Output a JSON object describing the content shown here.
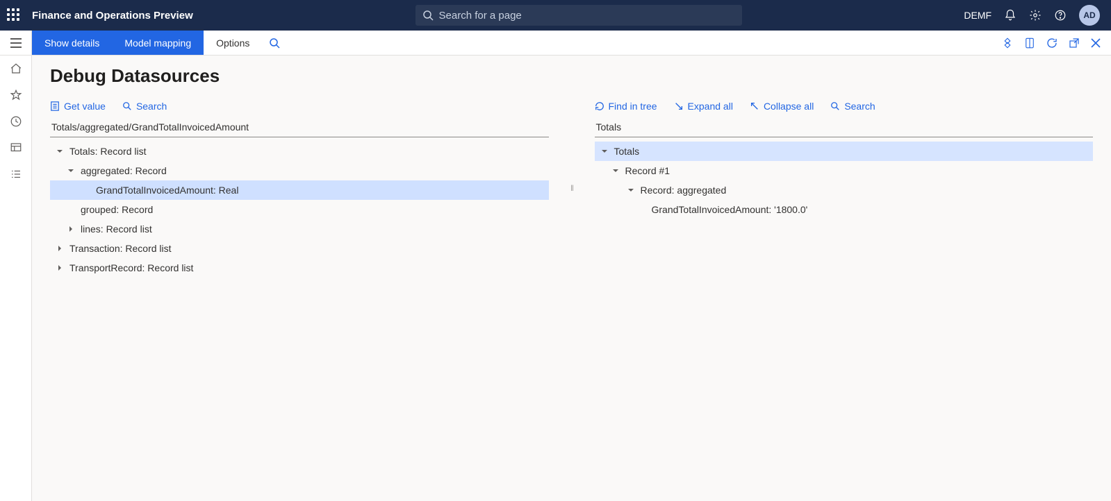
{
  "topbar": {
    "app_title": "Finance and Operations Preview",
    "search_placeholder": "Search for a page",
    "entity": "DEMF",
    "avatar_initials": "AD"
  },
  "ribbon": {
    "show_details": "Show details",
    "model_mapping": "Model mapping",
    "options": "Options"
  },
  "page": {
    "title": "Debug Datasources"
  },
  "left_panel": {
    "toolbar": {
      "get_value": "Get value",
      "search": "Search"
    },
    "path": "Totals/aggregated/GrandTotalInvoicedAmount",
    "tree": [
      {
        "level": 0,
        "caret": "down",
        "label": "Totals: Record list",
        "selected": false
      },
      {
        "level": 1,
        "caret": "down",
        "label": "aggregated: Record",
        "selected": false
      },
      {
        "level": 2,
        "caret": "none",
        "label": "GrandTotalInvoicedAmount: Real",
        "selected": true
      },
      {
        "level": 1,
        "caret": "none",
        "label": "grouped: Record",
        "selected": false
      },
      {
        "level": 1,
        "caret": "right",
        "label": "lines: Record list",
        "selected": false
      },
      {
        "level": 0,
        "caret": "right",
        "label": "Transaction: Record list",
        "selected": false
      },
      {
        "level": 0,
        "caret": "right",
        "label": "TransportRecord: Record list",
        "selected": false
      }
    ]
  },
  "right_panel": {
    "toolbar": {
      "find_in_tree": "Find in tree",
      "expand_all": "Expand all",
      "collapse_all": "Collapse all",
      "search": "Search"
    },
    "path": "Totals",
    "tree": [
      {
        "level": 0,
        "caret": "down",
        "label": "Totals",
        "selected": true
      },
      {
        "level": 1,
        "caret": "down",
        "label": "Record #1",
        "selected": false
      },
      {
        "level": 2,
        "caret": "down",
        "label": "Record: aggregated",
        "selected": false
      },
      {
        "level": 3,
        "caret": "none",
        "label": "GrandTotalInvoicedAmount: '1800.0'",
        "selected": false
      }
    ]
  }
}
